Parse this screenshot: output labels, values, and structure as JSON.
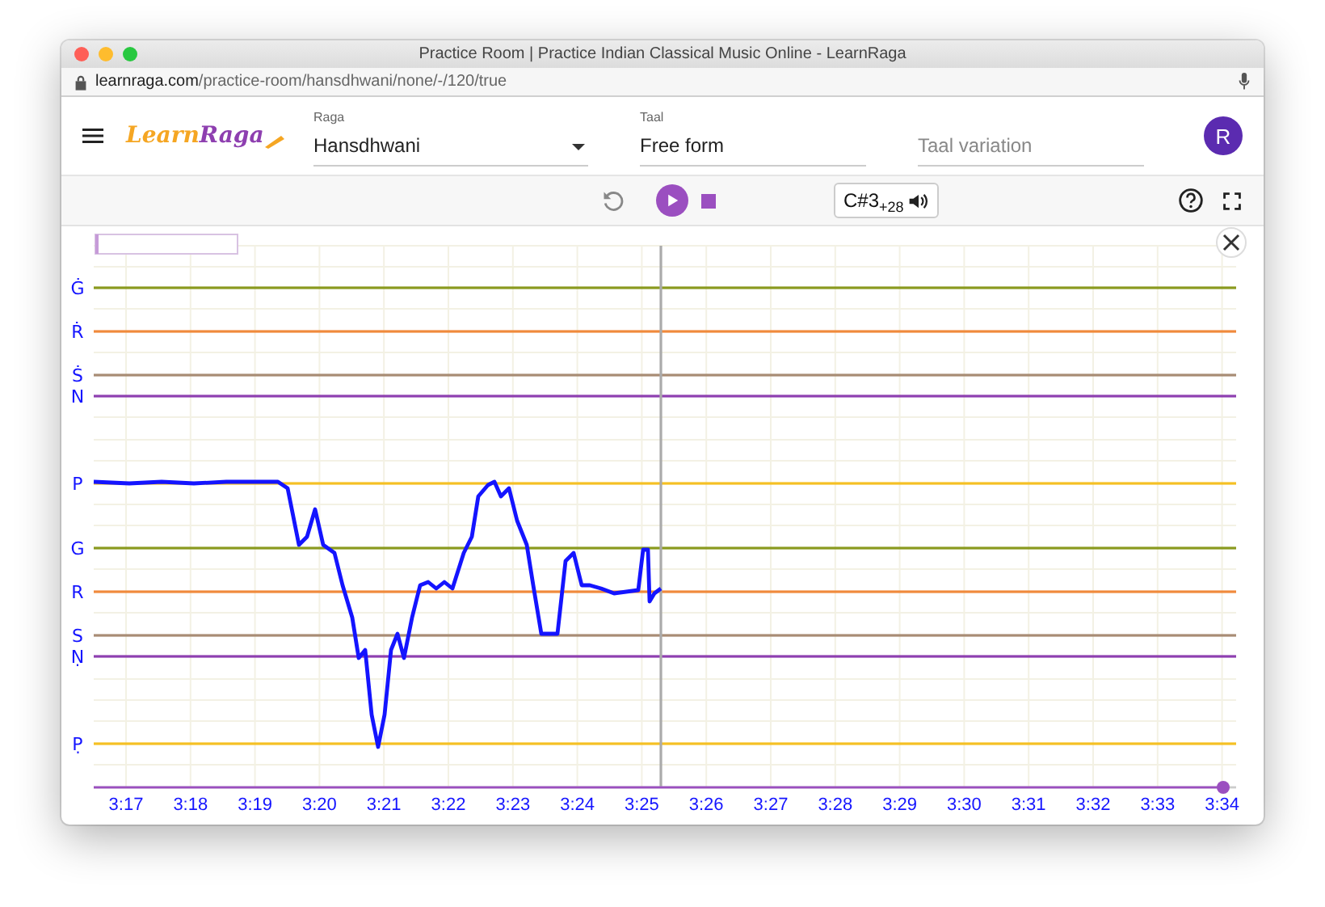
{
  "window": {
    "title": "Practice Room | Practice Indian Classical Music Online - LearnRaga",
    "url_host": "learnraga.com",
    "url_path": "/practice-room/hansdhwani/none/-/120/true"
  },
  "header": {
    "logo": {
      "part_1": "Learn",
      "part_2": "Raga"
    },
    "raga": {
      "label": "Raga",
      "value": "Hansdhwani"
    },
    "taal": {
      "label": "Taal",
      "value": "Free form"
    },
    "taal_variation": {
      "placeholder": "Taal variation"
    },
    "avatar": "R"
  },
  "toolbar": {
    "pitch": {
      "note": "C#3",
      "offset": "+28"
    }
  },
  "note_lines": [
    {
      "label": "Ġ",
      "color": "#8a9a1e"
    },
    {
      "label": "Ṙ",
      "color": "#f08a3c"
    },
    {
      "label": "Ṡ",
      "color": "#a88c74"
    },
    {
      "label": "N",
      "color": "#8e3fb0"
    },
    {
      "label": "P",
      "color": "#f5c024"
    },
    {
      "label": "G",
      "color": "#8a9a1e"
    },
    {
      "label": "R",
      "color": "#f08a3c"
    },
    {
      "label": "S",
      "color": "#a88c74"
    },
    {
      "label": "Ṇ",
      "color": "#8e3fb0"
    },
    {
      "label": "P̣",
      "color": "#f5c024"
    }
  ],
  "time_ticks": [
    "3:17",
    "3:18",
    "3:19",
    "3:20",
    "3:21",
    "3:22",
    "3:23",
    "3:24",
    "3:25",
    "3:26",
    "3:27",
    "3:28",
    "3:29",
    "3:30",
    "3:31",
    "3:32",
    "3:33",
    "3:34"
  ],
  "timeline": {
    "level": 1
  }
}
